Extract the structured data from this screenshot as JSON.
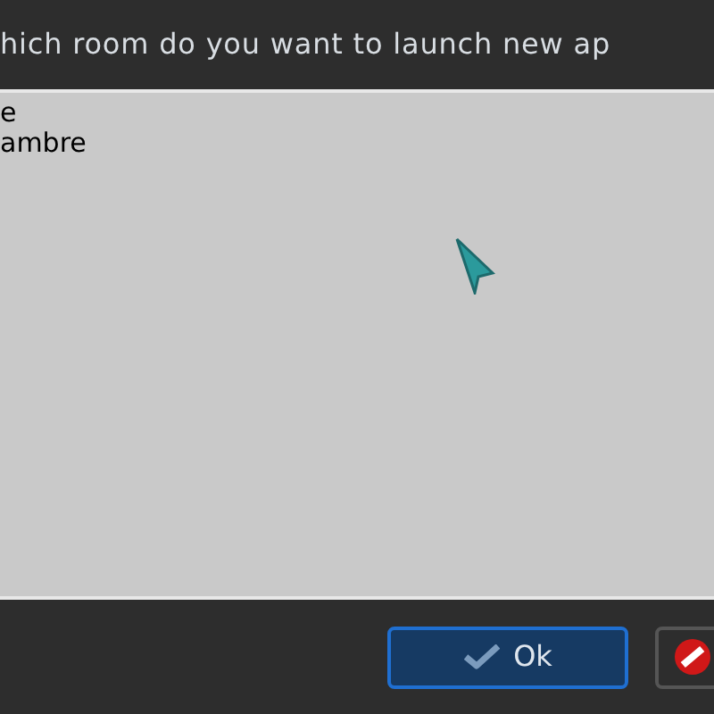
{
  "prompt": "hich room do you want to launch new ap",
  "rooms": [
    {
      "label": "e"
    },
    {
      "label": "ambre"
    }
  ],
  "buttons": [
    {
      "kind": "ok",
      "label": "Ok"
    },
    {
      "kind": "cancel"
    }
  ]
}
